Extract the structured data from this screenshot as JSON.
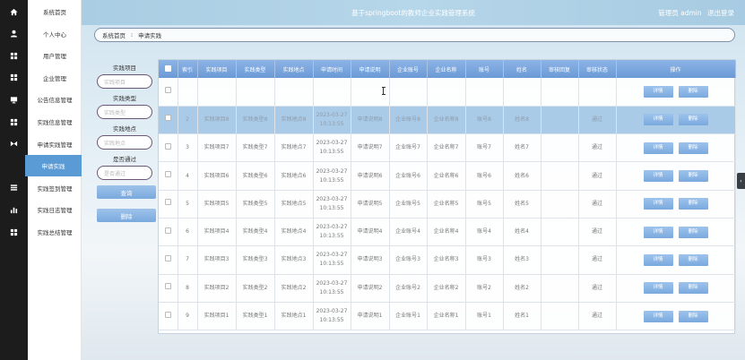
{
  "header": {
    "title": "基于springboot的教师企业实践管理系统",
    "user_role": "管理员 admin",
    "logout": "退出登录"
  },
  "sidebar": {
    "items": [
      {
        "label": "系统首页",
        "icon": "home-icon"
      },
      {
        "label": "个人中心",
        "icon": "user-icon"
      },
      {
        "label": "用户管理",
        "icon": "grid-icon"
      },
      {
        "label": "企业管理",
        "icon": "grid-icon"
      },
      {
        "label": "公告信息管理",
        "icon": "monitor-icon"
      },
      {
        "label": "实践信息管理",
        "icon": "grid-icon"
      },
      {
        "label": "申请实践管理",
        "icon": "bow-icon"
      },
      {
        "label": "申请实践",
        "icon": "none"
      },
      {
        "label": "实践签到管理",
        "icon": "list-icon"
      },
      {
        "label": "实践日志管理",
        "icon": "bar-chart-icon"
      },
      {
        "label": "实践总结管理",
        "icon": "grid-icon"
      }
    ],
    "active_index": 7
  },
  "breadcrumb": {
    "home": "系统首页",
    "current": "申请实践"
  },
  "search": {
    "project_label": "实践项目",
    "project_placeholder": "实践项目",
    "type_label": "实践类型",
    "type_placeholder": "实践类型",
    "location_label": "实践地点",
    "location_placeholder": "实践地点",
    "passed_label": "是否通过",
    "passed_placeholder": "是否通过",
    "query_button": "查询",
    "delete_button": "删除"
  },
  "table": {
    "columns": [
      "索引",
      "实践项目",
      "实践类型",
      "实践地点",
      "申请时间",
      "申请说明",
      "企业账号",
      "企业名称",
      "账号",
      "姓名",
      "审核回复",
      "审核状态",
      "操作"
    ],
    "detail_label": "详情",
    "delete_label": "删除",
    "rows": [
      {
        "index": "",
        "project": "",
        "type": "",
        "location": "",
        "time": "",
        "desc": "",
        "company_account": "",
        "company_name": "",
        "account": "",
        "name": "",
        "reply": "",
        "status": ""
      },
      {
        "index": "2",
        "project": "实践项目8",
        "type": "实践类型8",
        "location": "实践地点8",
        "time": "2023-03-27 10:13:55",
        "desc": "申请说明8",
        "company_account": "企业账号8",
        "company_name": "企业名称8",
        "account": "账号8",
        "name": "姓名8",
        "reply": "",
        "status": "通过"
      },
      {
        "index": "3",
        "project": "实践项目7",
        "type": "实践类型7",
        "location": "实践地点7",
        "time": "2023-03-27 10:13:55",
        "desc": "申请说明7",
        "company_account": "企业账号7",
        "company_name": "企业名称7",
        "account": "账号7",
        "name": "姓名7",
        "reply": "",
        "status": "通过"
      },
      {
        "index": "4",
        "project": "实践项目6",
        "type": "实践类型6",
        "location": "实践地点6",
        "time": "2023-03-27 10:13:55",
        "desc": "申请说明6",
        "company_account": "企业账号6",
        "company_name": "企业名称6",
        "account": "账号6",
        "name": "姓名6",
        "reply": "",
        "status": "通过"
      },
      {
        "index": "5",
        "project": "实践项目5",
        "type": "实践类型5",
        "location": "实践地点5",
        "time": "2023-03-27 10:13:55",
        "desc": "申请说明5",
        "company_account": "企业账号5",
        "company_name": "企业名称5",
        "account": "账号5",
        "name": "姓名5",
        "reply": "",
        "status": "通过"
      },
      {
        "index": "6",
        "project": "实践项目4",
        "type": "实践类型4",
        "location": "实践地点4",
        "time": "2023-03-27 10:13:55",
        "desc": "申请说明4",
        "company_account": "企业账号4",
        "company_name": "企业名称4",
        "account": "账号4",
        "name": "姓名4",
        "reply": "",
        "status": "通过"
      },
      {
        "index": "7",
        "project": "实践项目3",
        "type": "实践类型3",
        "location": "实践地点3",
        "time": "2023-03-27 10:13:55",
        "desc": "申请说明3",
        "company_account": "企业账号3",
        "company_name": "企业名称3",
        "account": "账号3",
        "name": "姓名3",
        "reply": "",
        "status": "通过"
      },
      {
        "index": "8",
        "project": "实践项目2",
        "type": "实践类型2",
        "location": "实践地点2",
        "time": "2023-03-27 10:13:55",
        "desc": "申请说明2",
        "company_account": "企业账号2",
        "company_name": "企业名称2",
        "account": "账号2",
        "name": "姓名2",
        "reply": "",
        "status": "通过"
      },
      {
        "index": "9",
        "project": "实践项目1",
        "type": "实践类型1",
        "location": "实践地点1",
        "time": "2023-03-27 10:13:55",
        "desc": "申请说明1",
        "company_account": "企业账号1",
        "company_name": "企业名称1",
        "account": "账号1",
        "name": "姓名1",
        "reply": "",
        "status": "通过"
      }
    ],
    "selected_row": 1
  },
  "colors": {
    "accent": "#5b9bd5",
    "header_bg": "#b6d6e9",
    "rail_bg": "#1c1c1c",
    "selected_row": "#a9cbe8"
  }
}
